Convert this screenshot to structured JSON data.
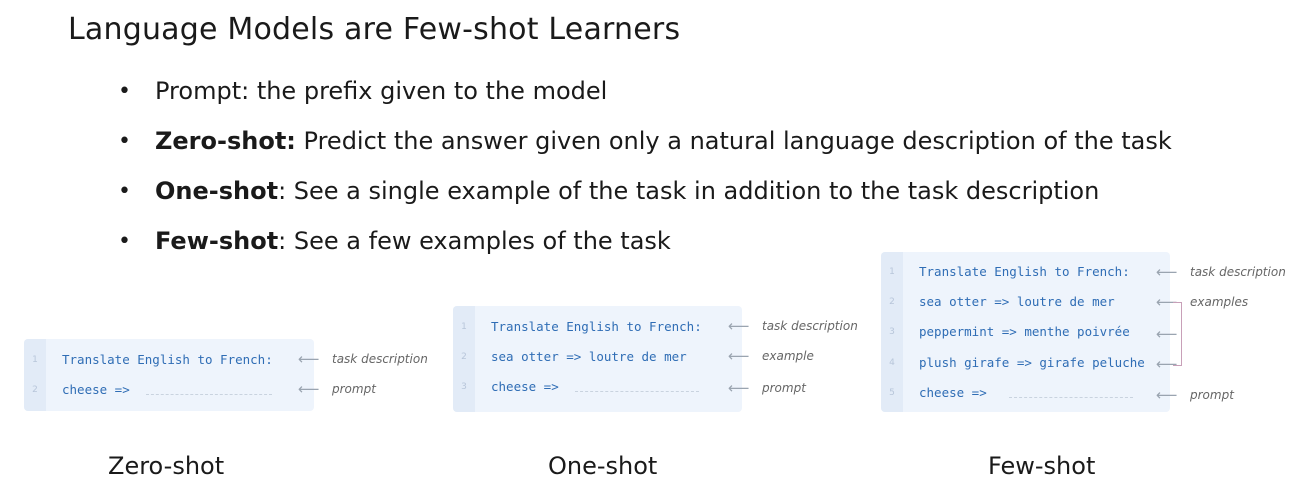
{
  "title": "Language Models are Few-shot Learners",
  "bullets": [
    {
      "bold": "",
      "text": "Prompt: the prefix given to the model"
    },
    {
      "bold": "Zero-shot:",
      "text": " Predict the answer given only a natural language description of the task"
    },
    {
      "bold": "One-shot",
      "text": ": See a single example of the task in addition to the task description"
    },
    {
      "bold": "Few-shot",
      "text": ": See a few examples of the task"
    }
  ],
  "bullet_glyph": "•",
  "panels": {
    "zero_shot": {
      "caption": "Zero-shot",
      "lines": [
        {
          "n": "1",
          "code": "Translate English to French:"
        },
        {
          "n": "2",
          "code": "cheese =>"
        }
      ],
      "annotations": [
        "task description",
        "prompt"
      ]
    },
    "one_shot": {
      "caption": "One-shot",
      "lines": [
        {
          "n": "1",
          "code": "Translate English to French:"
        },
        {
          "n": "2",
          "code": "sea otter => loutre de mer"
        },
        {
          "n": "3",
          "code": "cheese =>"
        }
      ],
      "annotations": [
        "task description",
        "example",
        "prompt"
      ]
    },
    "few_shot": {
      "caption": "Few-shot",
      "lines": [
        {
          "n": "1",
          "code": "Translate English to French:"
        },
        {
          "n": "2",
          "code": "sea otter => loutre de mer"
        },
        {
          "n": "3",
          "code": "peppermint => menthe poivrée"
        },
        {
          "n": "4",
          "code": "plush girafe => girafe peluche"
        },
        {
          "n": "5",
          "code": "cheese =>"
        }
      ],
      "annotations": [
        "task description",
        "examples",
        "prompt"
      ]
    }
  },
  "arrow_glyph": "⟵"
}
